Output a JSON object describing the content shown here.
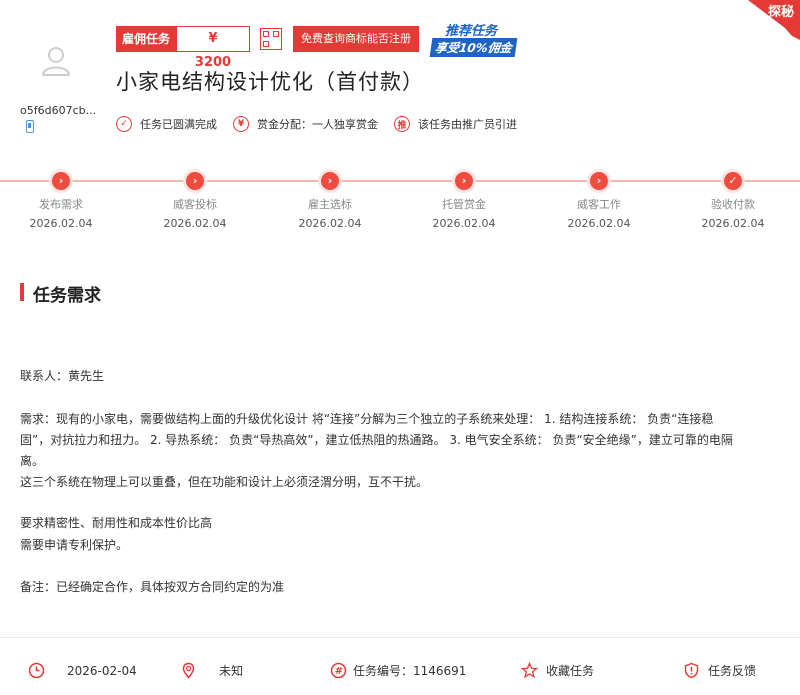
{
  "user": {
    "id": "o5f6d607cb..."
  },
  "task_tag": {
    "label": "雇佣任务",
    "price": "¥ 3200"
  },
  "check_button": "免费查询商标能否注册",
  "promo": {
    "line1": "推荐任务",
    "line2": "享受10%佣金"
  },
  "corner_badge": "探秘",
  "title": "小家电结构设计优化（首付款）",
  "info": [
    {
      "icon": "✓",
      "text": "任务已圆满完成"
    },
    {
      "icon": "¥",
      "text": "赏金分配：一人独享赏金"
    },
    {
      "icon": "推",
      "text": "该任务由推广员引进"
    }
  ],
  "steps": [
    {
      "name": "发布需求",
      "date": "2026.02.04",
      "icon": "›"
    },
    {
      "name": "威客投标",
      "date": "2026.02.04",
      "icon": "›"
    },
    {
      "name": "雇主选标",
      "date": "2026.02.04",
      "icon": "›"
    },
    {
      "name": "托管赏金",
      "date": "2026.02.04",
      "icon": "›"
    },
    {
      "name": "威客工作",
      "date": "2026.02.04",
      "icon": "›"
    },
    {
      "name": "验收付款",
      "date": "2026.02.04",
      "icon": "✓"
    }
  ],
  "section_title": "任务需求",
  "content": {
    "contact": "联系人：黄先生",
    "demand1": "需求：现有的小家电，需要做结构上面的升级优化设计 将“连接”分解为三个独立的子系统来处理： 1. 结构连接系统： 负责“连接稳",
    "demand2": "固”，对抗拉力和扭力。 2. 导热系统： 负责“导热高效”，建立低热阻的热通路。 3. 电气安全系统： 负责“安全绝缘”，建立可靠的电隔",
    "demand3": "离。",
    "demand4": "这三个系统在物理上可以重叠，但在功能和设计上必须泾渭分明，互不干扰。",
    "req1": "要求精密性、耐用性和成本性价比高",
    "req2": "需要申请专利保护。",
    "note": "备注：已经确定合作，具体按双方合同约定的为准"
  },
  "footer": {
    "date": "2026-02-04",
    "location": "未知",
    "task_no": "任务编号：1146691",
    "favorite": "收藏任务",
    "feedback": "任务反馈"
  }
}
